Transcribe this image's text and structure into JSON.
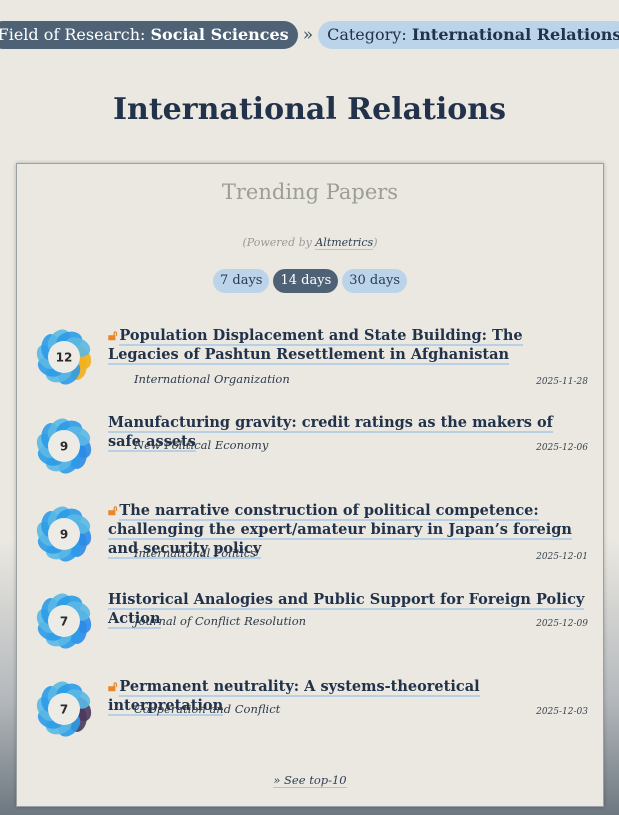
{
  "breadcrumb": {
    "field_prefix": "Field of Research: ",
    "field_value": "Social Sciences",
    "separator": "»",
    "category_prefix": "Category: ",
    "category_value": "International Relations"
  },
  "page_title": "International Relations",
  "panel": {
    "title": "Trending Papers",
    "powered_prefix": "(Powered by ",
    "powered_link": "Altmetrics",
    "powered_suffix": ")",
    "tabs": [
      {
        "label": "7 days",
        "active": false
      },
      {
        "label": "14 days",
        "active": true
      },
      {
        "label": "30 days",
        "active": false
      }
    ],
    "see_top": "» See top-10"
  },
  "papers": [
    {
      "score": "12",
      "open_access": true,
      "title": "Population Displacement and State Building: The Legacies of Pashtun Resettlement in Afghanistan",
      "journal": "International Organization",
      "date": "2025-11-28",
      "ring_colors": [
        "#f2b01e",
        "#2b9be8",
        "#5ab8e6"
      ]
    },
    {
      "score": "9",
      "open_access": false,
      "title": "Manufacturing gravity: credit ratings as the makers of safe assets",
      "journal": "New Political Economy",
      "date": "2025-12-06",
      "ring_colors": [
        "#2b8be8",
        "#2b9be8",
        "#5ab8e6"
      ]
    },
    {
      "score": "9",
      "open_access": true,
      "title": "The narrative construction of political competence: challenging the expert/amateur binary in Japan’s foreign and security policy",
      "journal": "International Politics",
      "date": "2025-12-01",
      "ring_colors": [
        "#2b8be8",
        "#2b9be8",
        "#5ab8e6"
      ]
    },
    {
      "score": "7",
      "open_access": false,
      "title": "Historical Analogies and Public Support for Foreign Policy Action",
      "journal": "Journal of Conflict Resolution",
      "date": "2025-12-09",
      "ring_colors": [
        "#2b8be8",
        "#2b9be8",
        "#5ab8e6"
      ]
    },
    {
      "score": "7",
      "open_access": true,
      "title": "Permanent neutrality: A systems-theoretical interpretation",
      "journal": "Cooperation and Conflict",
      "date": "2025-12-03",
      "ring_colors": [
        "#4a3a5e",
        "#2b9be8",
        "#5ab8e6"
      ]
    }
  ],
  "icons": {
    "open_access": "open-lock-icon",
    "score_badge": "altmetric-donut-icon"
  },
  "colors": {
    "dark_pill": "#4f6275",
    "light_pill": "#bcd4ea",
    "open_access": "#e8862a"
  }
}
